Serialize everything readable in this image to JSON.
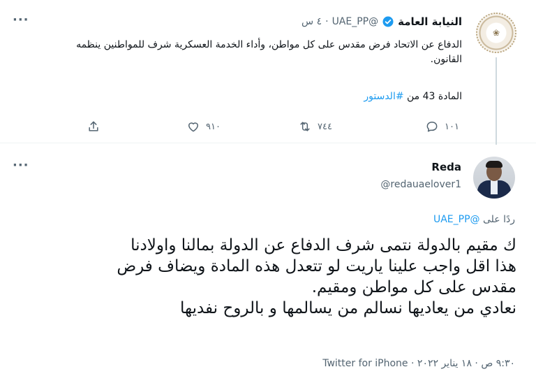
{
  "parent_tweet": {
    "author_name": "النيابة العامة",
    "author_handle": "@UAE_PP",
    "dot": "·",
    "time": "٤ س",
    "text": "الدفاع عن الاتحاد فرض مقدس على كل مواطن، وأداء الخدمة العسكرية شرف للمواطنين ينظمه القانون.",
    "article_prefix": "المادة 43 من ",
    "article_hashtag": "#الدستور",
    "reply_count": "١٠١",
    "retweet_count": "٧٤٤",
    "like_count": "٩١٠",
    "icons": [
      "reply-icon",
      "retweet-icon",
      "like-icon",
      "share-icon",
      "more-icon",
      "verified-icon"
    ]
  },
  "main_tweet": {
    "author_name": "Reda",
    "author_handle": "@redauaelover1",
    "reply_prefix": "ردًا على ",
    "reply_mention": "@UAE_PP",
    "text_line1": "ك مقيم بالدولة نتمى شرف الدفاع عن الدولة بمالنا واولادنا",
    "text_line2": "هذا اقل واجب علينا ياريت لو تتعدل هذه المادة ويضاف فرض",
    "text_line3": "مقدس على كل مواطن ومقيم.",
    "text_line4": "نعادي من يعاديها نسالم من يسالمها و بالروح نفديها",
    "time": "٩:٣٠ ص",
    "date": "١٨ يناير ٢٠٢٢",
    "dot": "·",
    "source": "Twitter for iPhone"
  },
  "colors": {
    "accent": "#1d9bf0",
    "secondary_text": "#536471",
    "primary_text": "#0f1419",
    "divider": "#eff3f4"
  }
}
